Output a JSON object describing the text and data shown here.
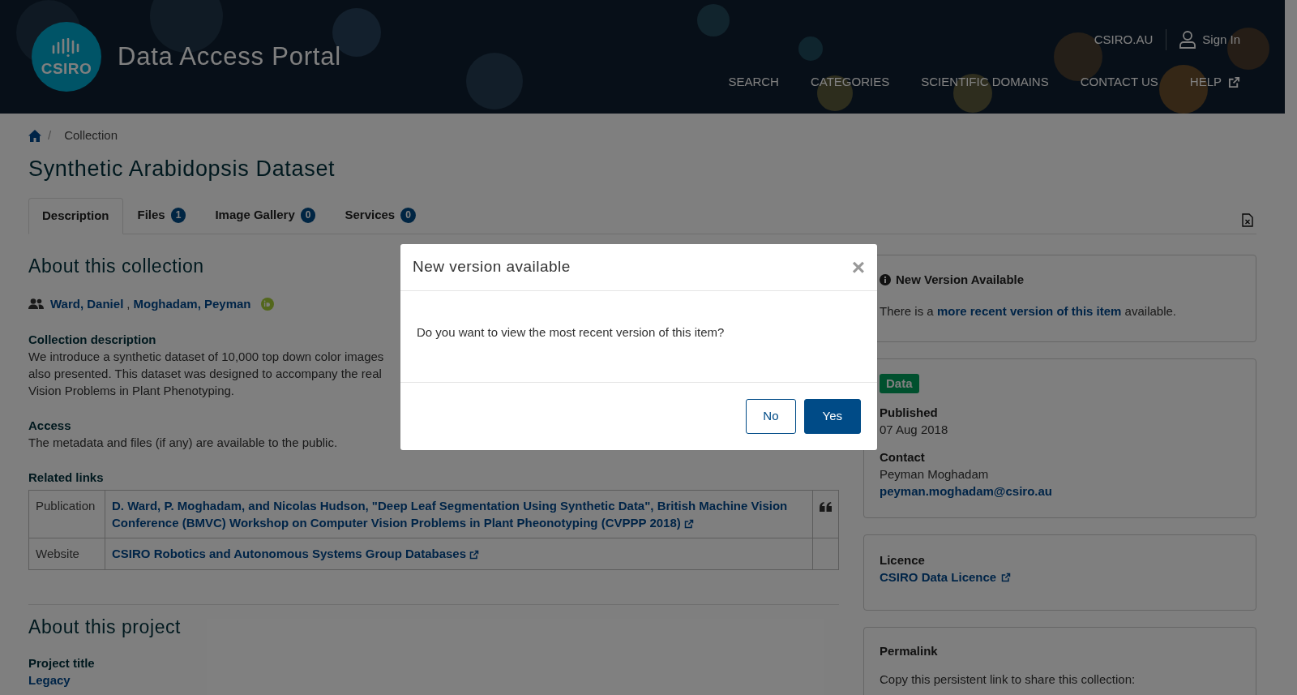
{
  "header": {
    "logo_text": "CSIRO",
    "site_title": "Data Access Portal",
    "top_links": [
      {
        "label": "CSIRO.AU",
        "kind": "link"
      },
      {
        "label": "Sign In",
        "kind": "user"
      }
    ],
    "nav": [
      {
        "label": "SEARCH",
        "external": false
      },
      {
        "label": "CATEGORIES",
        "external": false
      },
      {
        "label": "SCIENTIFIC DOMAINS",
        "external": false
      },
      {
        "label": "CONTACT US",
        "external": false
      },
      {
        "label": "HELP",
        "external": true
      }
    ]
  },
  "breadcrumb": {
    "separator": "/",
    "items": [
      "Collection"
    ]
  },
  "page_title": "Synthetic Arabidopsis Dataset",
  "tabs": [
    {
      "label": "Description",
      "selected": true
    },
    {
      "label": "Files",
      "count": "1",
      "selected": false
    },
    {
      "label": "Image Gallery",
      "count": "0",
      "selected": false
    },
    {
      "label": "Services",
      "count": "0",
      "selected": false
    }
  ],
  "about": {
    "heading": "About this collection",
    "author_separator": ",",
    "authors": [
      {
        "name": "Ward, Daniel",
        "orcid": false
      },
      {
        "name": "Moghadam, Peyman",
        "orcid": true
      }
    ],
    "sections": [
      {
        "heading": "Collection description",
        "lines": [
          "We introduce a synthetic dataset of 10,000 top down color images",
          "also presented. This dataset was designed to accompany the real",
          "Vision Problems in Plant Phenotyping."
        ]
      },
      {
        "heading": "Access",
        "lines": [
          "The metadata and files (if any) are available to the public."
        ]
      }
    ]
  },
  "related_links": {
    "heading": "Related links",
    "rows": [
      {
        "type": "Publication",
        "link": "D. Ward, P. Moghadam, and Nicolas Hudson, \"Deep Leaf Segmentation Using Synthetic Data\", British Machine Vision Conference (BMVC) Workshop on Computer Vision Problems in Plant Pheonotyping (CVPPP 2018)",
        "cite": true
      },
      {
        "type": "Website",
        "link": "CSIRO Robotics and Autonomous Systems Group Databases",
        "cite": false
      }
    ]
  },
  "project": {
    "heading": "About this project",
    "fields": [
      {
        "label": "Project title",
        "value": "Legacy"
      }
    ]
  },
  "sidebar": {
    "notice": {
      "title": "New Version Available",
      "before": "There is a",
      "link": "more recent version of this item",
      "after": "available."
    },
    "details": {
      "badge": {
        "label": "Data"
      },
      "fields": [
        {
          "label": "Published",
          "value": "07 Aug 2018",
          "kind": "text"
        },
        {
          "label": "Contact",
          "value": "Peyman Moghadam",
          "email": "peyman.moghadam@csiro.au",
          "kind": "contact"
        }
      ]
    },
    "licence": {
      "label": "Licence",
      "link": "CSIRO Data Licence"
    },
    "permalink": {
      "label": "Permalink",
      "text": "Copy this persistent link to share this collection:"
    }
  },
  "modal": {
    "title": "New version available",
    "close": "×",
    "message": "Do you want to view the most recent version of this item?",
    "buttons": [
      {
        "label": "No",
        "primary": false
      },
      {
        "label": "Yes",
        "primary": true
      }
    ]
  }
}
